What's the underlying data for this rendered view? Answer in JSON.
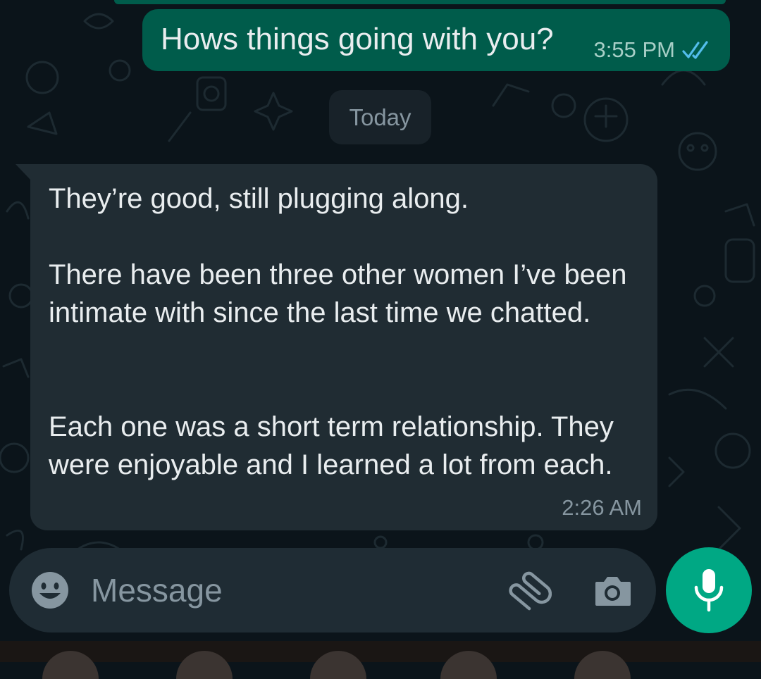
{
  "conversation": {
    "sent_message": {
      "text": "Hows things going with you?",
      "time": "3:55 PM",
      "status_icon": "double-check-read-icon"
    },
    "date_divider": "Today",
    "received_message": {
      "paragraphs": [
        "They’re good, still plugging along.",
        "There have been three other women I’ve been intimate with since the last time we chatted.",
        "Each one was a short term relationship. They were enjoyable and I learned a lot from each."
      ],
      "time": "2:26 AM"
    }
  },
  "composer": {
    "placeholder": "Message",
    "value": "",
    "icons": {
      "emoji": "emoji-icon",
      "attach": "paperclip-icon",
      "camera": "camera-icon",
      "mic": "microphone-icon"
    }
  },
  "colors": {
    "background": "#0b141a",
    "outgoing_bubble": "#005c4b",
    "incoming_bubble": "#202c33",
    "composer": "#1f2c34",
    "accent": "#00a884",
    "read_ticks": "#53bdeb",
    "primary_text": "#e9edef",
    "secondary_text": "#8696a0"
  }
}
